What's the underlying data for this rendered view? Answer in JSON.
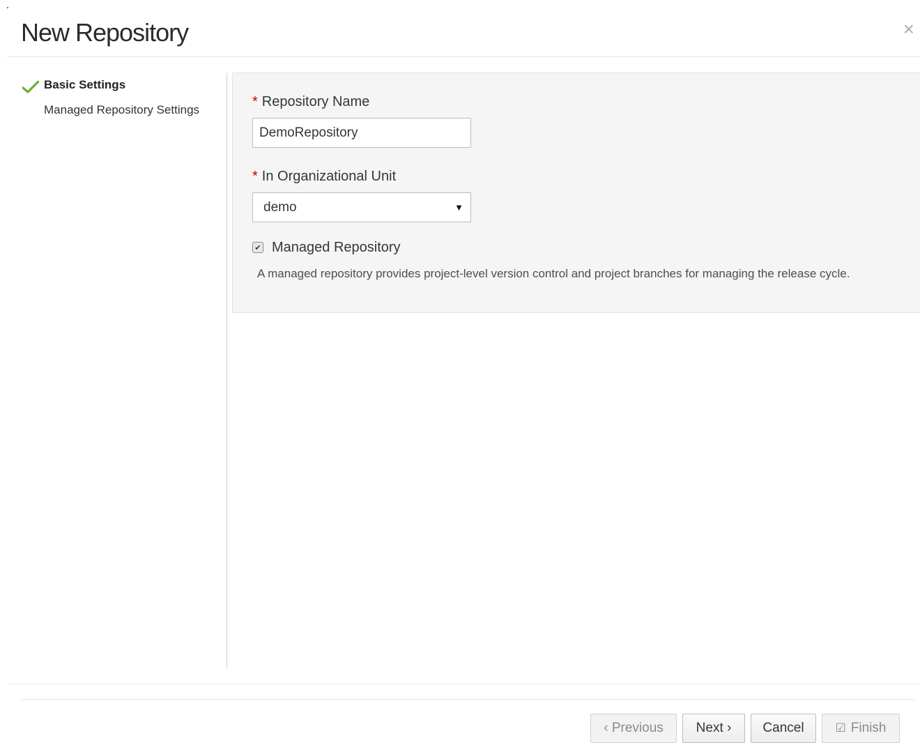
{
  "dialog": {
    "title": "New Repository",
    "close_glyph": "×"
  },
  "steps": [
    {
      "label": "Basic Settings",
      "active": true,
      "icon": "check-icon"
    },
    {
      "label": "Managed Repository Settings",
      "active": false
    }
  ],
  "form": {
    "repository_name": {
      "required_marker": "*",
      "label": "Repository Name",
      "value": "DemoRepository"
    },
    "org_unit": {
      "required_marker": "*",
      "label": "In Organizational Unit",
      "selected": "demo",
      "caret": "▼"
    },
    "managed": {
      "checked": true,
      "check_glyph": "✔",
      "label": "Managed Repository",
      "help": "A managed repository provides project-level version control and project branches for managing the release cycle."
    }
  },
  "footer": {
    "previous_label": "‹ Previous",
    "next_label": "Next ›",
    "cancel_label": "Cancel",
    "finish_icon_glyph": "☑",
    "finish_label": "Finish"
  },
  "colors": {
    "required": "#cc0000",
    "check": "#6cae2d",
    "panel_bg": "#f5f5f5"
  }
}
